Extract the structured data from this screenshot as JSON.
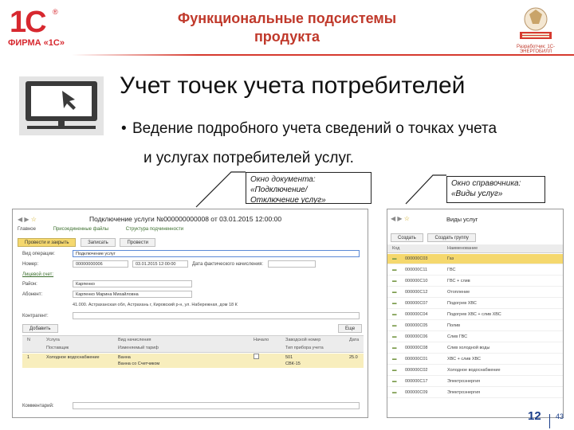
{
  "header": {
    "logo_text": "1С",
    "logo_reg": "®",
    "firm": "ФИРМА «1С»",
    "title": "Функциональные подсистемы продукта",
    "partner_caption": "Разработчик: 1С-ЭНЕРГОБИЛЛ"
  },
  "slide": {
    "title": "Учет точек учета потребителей",
    "bullet_marker": "•",
    "bullet_line1": "Ведение подробного учета сведений о точках учета",
    "bullet_line2": "и услугах потребителей услуг."
  },
  "callouts": {
    "doc_caption": "Окно документа:",
    "doc_name_1": "«Подключение/",
    "doc_name_2": "Отключение услуг»",
    "ref_caption": "Окно справочника:",
    "ref_name": "«Виды услуг»"
  },
  "doc_window": {
    "title": "Подключение услуги №000000000008 от 03.01.2015 12:00:00",
    "tabs": [
      "Главное",
      "Присоединенные файлы",
      "Структура подчиненности"
    ],
    "buttons": {
      "post_close": "Провести и закрыть",
      "save": "Записать",
      "post": "Провести"
    },
    "fields": {
      "operation_label": "Вид операции:",
      "operation_value": "Подключение услуг",
      "number_label": "Номер:",
      "number_value": "00000000006",
      "date_value": "03.01.2015 12:00:00",
      "date_fact_label": "Дата фактического начисления:",
      "consumer_label": "Лицевой счет:",
      "consumer_value": "Карпенко",
      "area_label": "Район:",
      "area_value": "Карпенко",
      "address_label": "Абонент:",
      "address_value": "Карпенко Марина Михайловна",
      "addr_text": "41.000. Астраханская обл, Астрахань г, Кировский р-н, ул. Набережная, дом 18 К",
      "contractor_label": "Контрагент:",
      "comment_label": "Комментарий:"
    },
    "table_buttons": {
      "add": "Добавить",
      "more": "Еще"
    },
    "table_headers": [
      "N",
      "Услуга",
      "Вид начисления",
      "Начало",
      "Заводской номер",
      "Дата"
    ],
    "table_subheaders": [
      "Поставщик",
      "Изменяемый тариф",
      "Тип прибора учета"
    ],
    "row": [
      "1",
      "Холодное водоснабжение",
      "Ванна",
      "501",
      "25.0"
    ],
    "row_sub": [
      "Ванна со Счетчиком",
      "СВК-15"
    ]
  },
  "cat_window": {
    "title": "Виды услуг",
    "buttons": {
      "create": "Создать",
      "create_group": "Создать группу"
    },
    "headers": [
      "Код",
      "Наименование"
    ],
    "rows": [
      {
        "code": "000000C03",
        "name": "Газ",
        "selected": true
      },
      {
        "code": "000000C11",
        "name": "ГВС",
        "selected": false
      },
      {
        "code": "000000C10",
        "name": "ГВС + слив",
        "selected": false
      },
      {
        "code": "000000C12",
        "name": "Отопление",
        "selected": false
      },
      {
        "code": "000000C07",
        "name": "Подогрев ХВС",
        "selected": false
      },
      {
        "code": "000000C04",
        "name": "Подогрев ХВС + слив ХВС",
        "selected": false
      },
      {
        "code": "000000C05",
        "name": "Полив",
        "selected": false
      },
      {
        "code": "000000C06",
        "name": "Слив ГВС",
        "selected": false
      },
      {
        "code": "000000C08",
        "name": "Слив холодной воды",
        "selected": false
      },
      {
        "code": "000000C01",
        "name": "ХВС + слив ХВС",
        "selected": false
      },
      {
        "code": "000000C02",
        "name": "Холодное водоснабжение",
        "selected": false
      },
      {
        "code": "000000C17",
        "name": "Электроэнергия",
        "selected": false
      },
      {
        "code": "000000C09",
        "name": "Электроэнергия",
        "selected": false
      }
    ]
  },
  "footer": {
    "page": "12",
    "total": "43"
  },
  "colors": {
    "brand_red": "#d7282f",
    "accent_yellow": "#f5d86e",
    "page_blue": "#1a3e8a"
  }
}
